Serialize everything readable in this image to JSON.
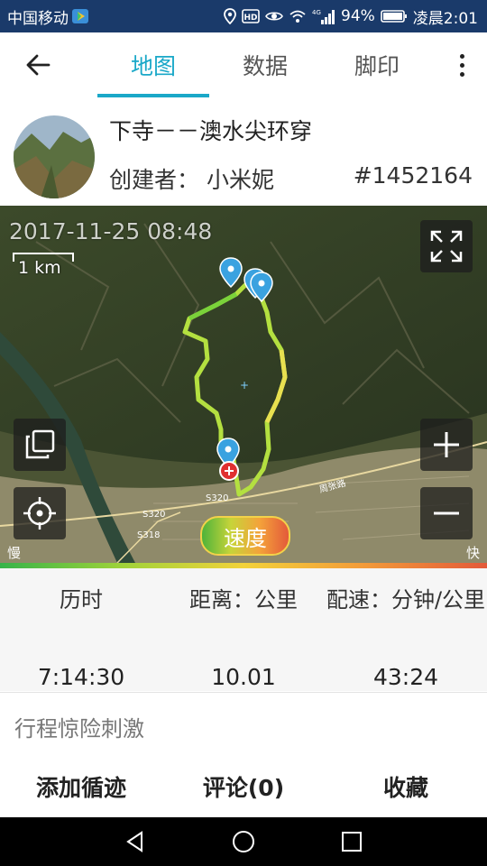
{
  "status_bar": {
    "carrier": "中国移动",
    "network": "4G",
    "battery": "94%",
    "time": "凌晨2:01",
    "icons": [
      "play-store-icon",
      "location-icon",
      "hd-icon",
      "eye-icon",
      "wifi-icon",
      "signal-icon",
      "battery-icon"
    ]
  },
  "app_bar": {
    "tabs": [
      {
        "label": "地图",
        "active": true
      },
      {
        "label": "数据",
        "active": false
      },
      {
        "label": "脚印",
        "active": false
      }
    ],
    "accent_color": "#1aa8c8"
  },
  "trail": {
    "title": "下寺－－澳水尖环穿",
    "creator": "创建者：  小米妮",
    "id": "#1452164"
  },
  "map": {
    "timestamp": "2017-11-25 08:48",
    "scale_label": "1 km",
    "speed_button": "速度",
    "slow_label": "慢",
    "fast_label": "快",
    "road_labels": [
      "S320",
      "S320",
      "S318",
      "周张路"
    ],
    "controls": [
      "fullscreen-icon",
      "copy-layers-icon",
      "locate-icon",
      "zoom-in-icon",
      "zoom-out-icon"
    ]
  },
  "stats": [
    {
      "label": "历时",
      "value": "7:14:30"
    },
    {
      "label": "距离：公里",
      "value": "10.01"
    },
    {
      "label": "配速：分钟/公里",
      "value": "43:24"
    }
  ],
  "description": "行程惊险刺激",
  "actions": [
    "添加循迹",
    "评论(0)",
    "收藏"
  ]
}
